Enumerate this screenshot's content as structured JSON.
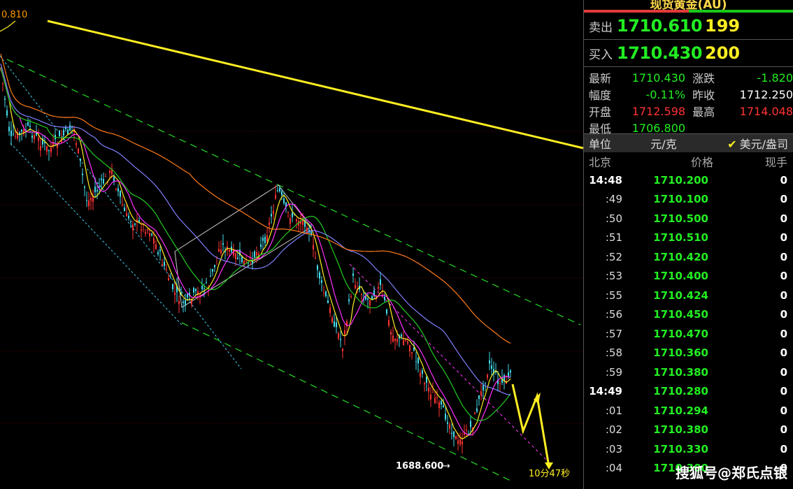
{
  "chart": {
    "top_left_value": "0.810",
    "low_label": "1688.600",
    "timer": "10分47秒"
  },
  "panel": {
    "title": "现货黄金(AU)",
    "sell": {
      "label": "卖出",
      "price": "1710.610",
      "vol": "199"
    },
    "buy": {
      "label": "买入",
      "price": "1710.430",
      "vol": "200"
    },
    "stats": [
      {
        "k": "最新",
        "v": "1710.430",
        "vc": "grn",
        "k2": "涨跌",
        "v2": "-1.820",
        "v2c": "grn"
      },
      {
        "k": "幅度",
        "v": "-0.11%",
        "vc": "grn",
        "k2": "昨收",
        "v2": "1712.250",
        "v2c": "wht"
      },
      {
        "k": "开盘",
        "v": "1712.598",
        "vc": "red",
        "k2": "最高",
        "v2": "1714.048",
        "v2c": "red"
      },
      {
        "k": "最低",
        "v": "1706.800",
        "vc": "grn",
        "k2": "",
        "v2": "",
        "v2c": "wht"
      }
    ],
    "unit": {
      "label": "单位",
      "value": "元/克",
      "alt": "美元/盎司"
    },
    "table_headers": {
      "time": "北京",
      "price": "价格",
      "qty": "现手"
    },
    "ticks": [
      {
        "t": "14:48",
        "p": "1710.200",
        "q": "0",
        "bold": true
      },
      {
        "t": ":49",
        "p": "1710.100",
        "q": "0"
      },
      {
        "t": ":50",
        "p": "1710.500",
        "q": "0"
      },
      {
        "t": ":51",
        "p": "1710.510",
        "q": "0"
      },
      {
        "t": ":52",
        "p": "1710.420",
        "q": "0"
      },
      {
        "t": ":53",
        "p": "1710.400",
        "q": "0"
      },
      {
        "t": ":55",
        "p": "1710.424",
        "q": "0"
      },
      {
        "t": ":56",
        "p": "1710.450",
        "q": "0"
      },
      {
        "t": ":57",
        "p": "1710.470",
        "q": "0"
      },
      {
        "t": ":58",
        "p": "1710.360",
        "q": "0"
      },
      {
        "t": ":59",
        "p": "1710.380",
        "q": "0"
      },
      {
        "t": "14:49",
        "p": "1710.280",
        "q": "0",
        "bold": true
      },
      {
        "t": ":01",
        "p": "1710.294",
        "q": "0"
      },
      {
        "t": ":02",
        "p": "1710.380",
        "q": "0"
      },
      {
        "t": ":03",
        "p": "1710.330",
        "q": "0"
      },
      {
        "t": ":04",
        "p": "1710.300",
        "q": "0"
      }
    ],
    "watermark": "搜狐号@郑氏点银"
  },
  "colors": {
    "up": "#ff3333",
    "down": "#22ee22",
    "accent": "#ffee22"
  }
}
